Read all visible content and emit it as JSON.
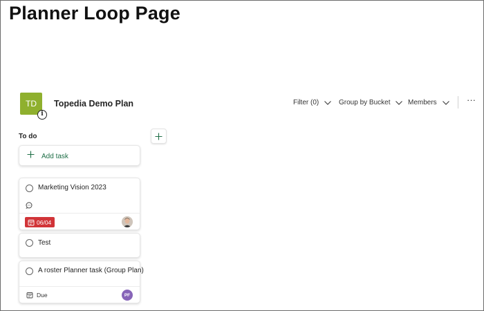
{
  "page": {
    "title": "Planner Loop Page"
  },
  "plan": {
    "avatar_initials": "TD",
    "info_badge": "i",
    "name": "Topedia Demo Plan",
    "avatar_color": "#8fb02e"
  },
  "toolbar": {
    "filter_label": "Filter (0)",
    "group_label": "Group by Bucket",
    "members_label": "Members",
    "more_label": "···"
  },
  "bucket": {
    "title": "To do",
    "add_task_label": "Add task"
  },
  "tasks": [
    {
      "title": "Marketing Vision 2023",
      "due_date": "06/04",
      "has_comment": true,
      "assignee": "photo",
      "due_color": "#d13438"
    },
    {
      "title": "Test"
    },
    {
      "title": "A roster Planner task (Group Plan)",
      "due_label": "Due",
      "assignee_initials": "PF",
      "assignee_color": "#8764b8"
    }
  ],
  "colors": {
    "accent_green": "#1e6e46"
  }
}
